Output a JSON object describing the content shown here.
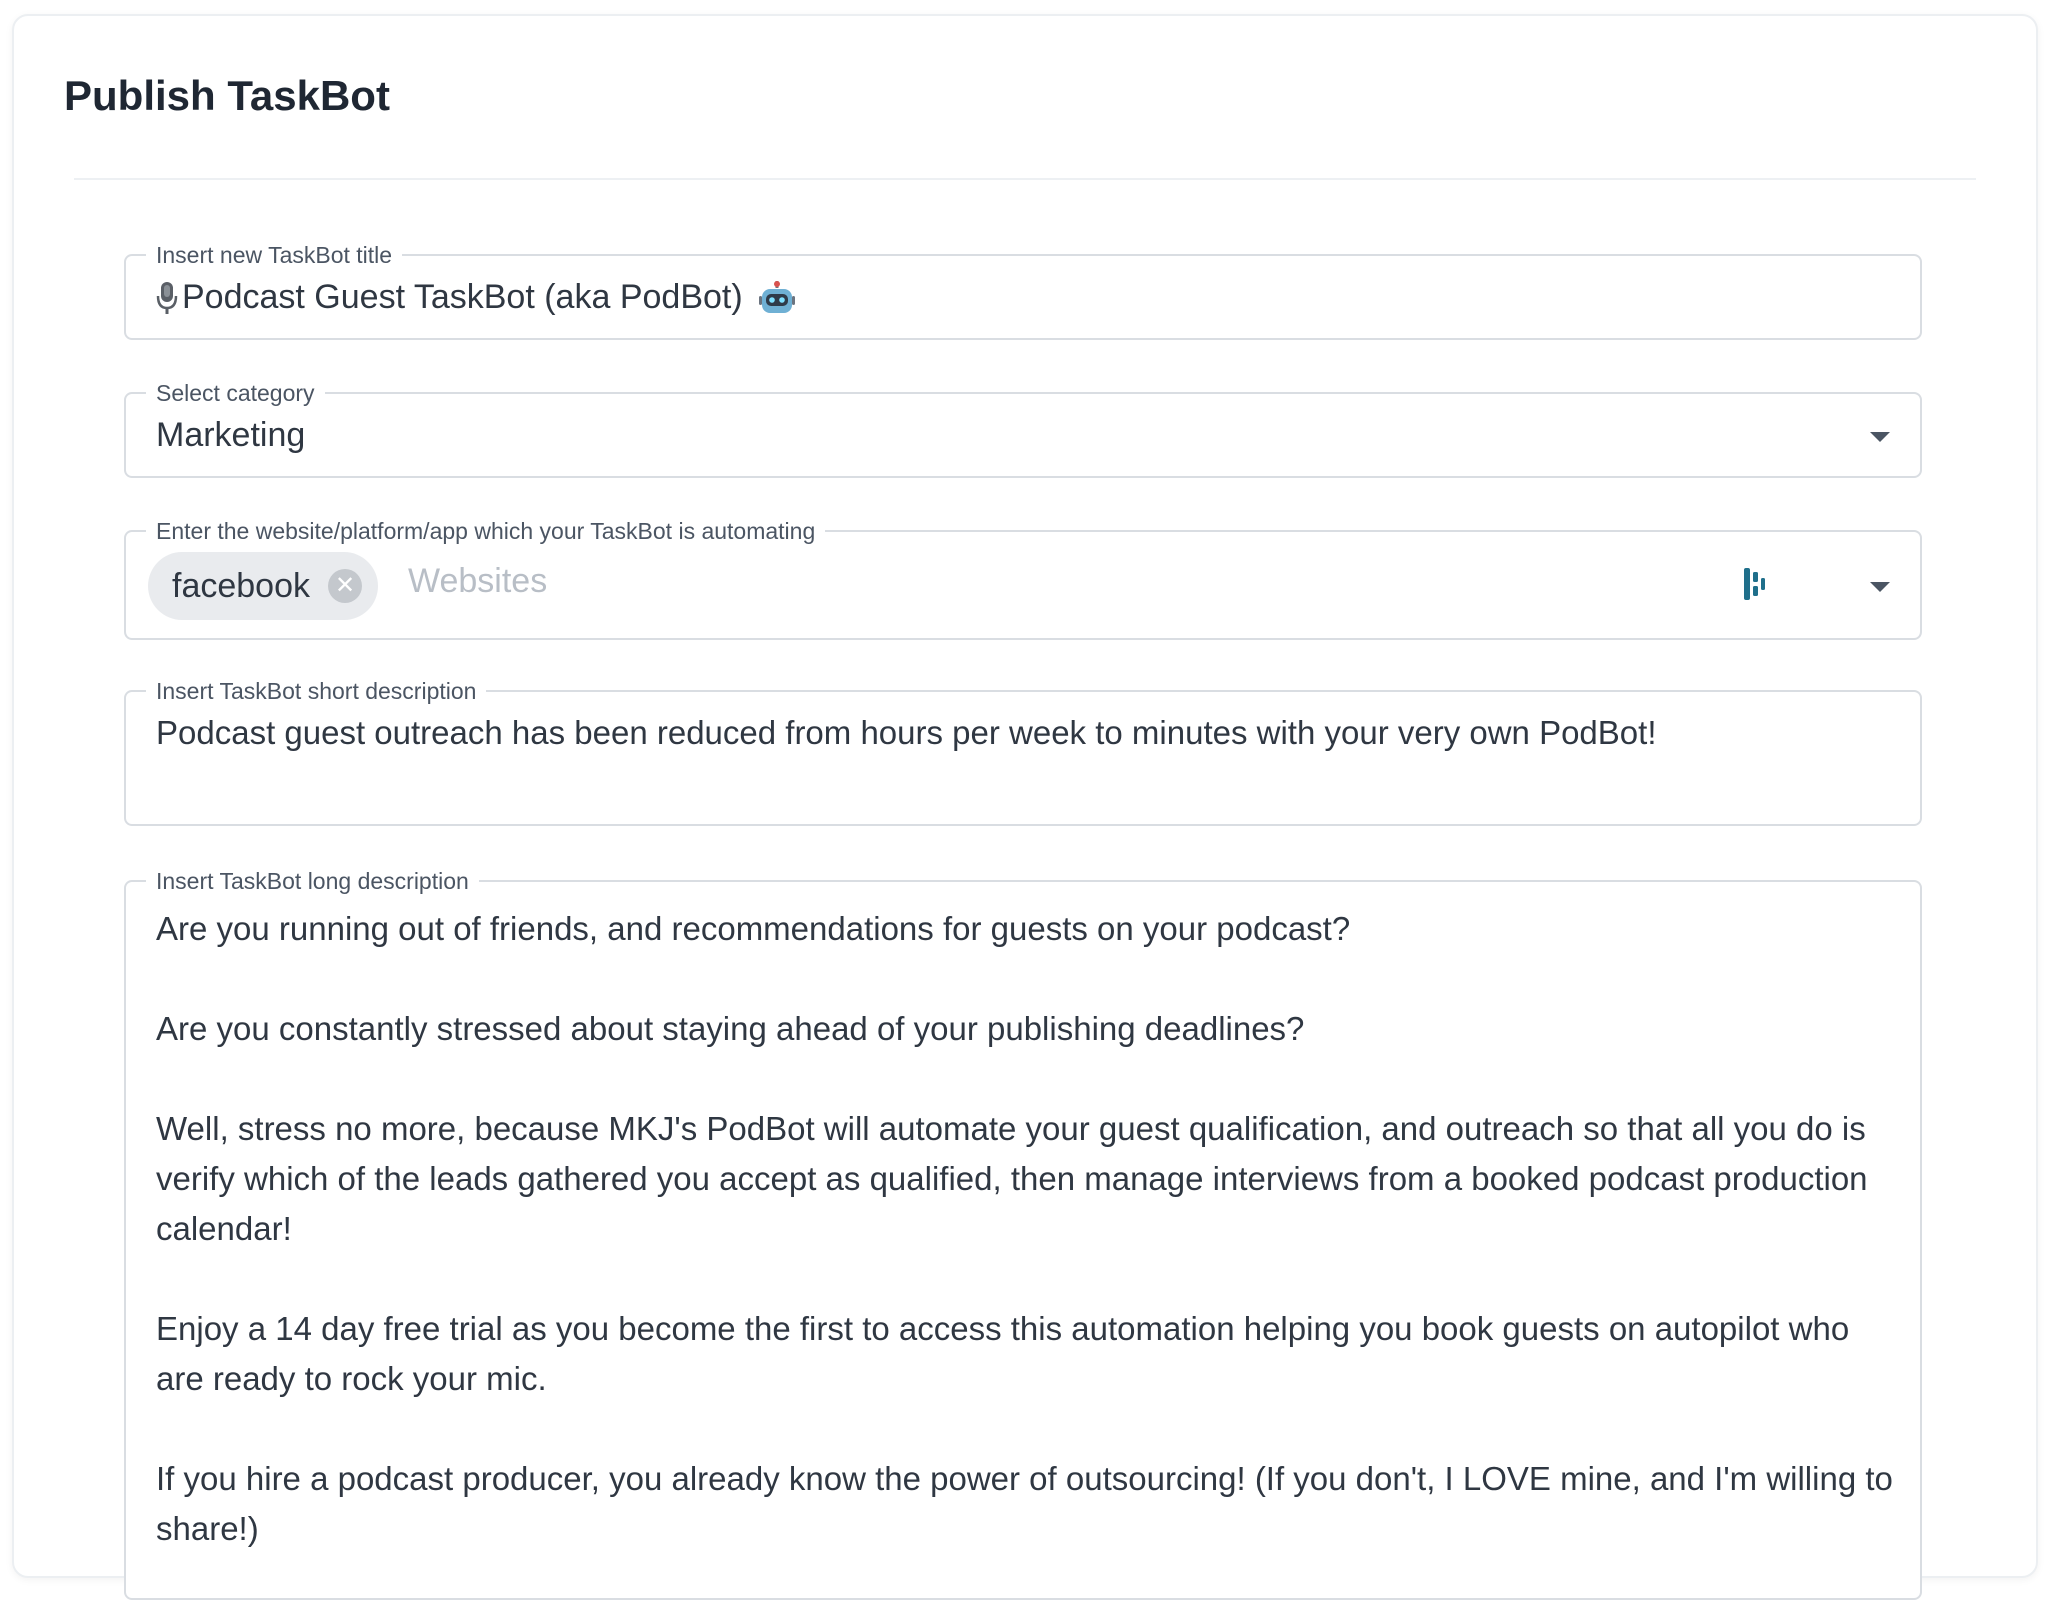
{
  "header": {
    "title": "Publish TaskBot"
  },
  "form": {
    "title_field": {
      "label": "Insert new TaskBot title",
      "value": "Podcast Guest TaskBot (aka PodBot)",
      "leading_icon": "microphone-icon",
      "trailing_icon": "robot-icon"
    },
    "category_field": {
      "label": "Select category",
      "value": "Marketing"
    },
    "website_field": {
      "label": "Enter the website/platform/app which your TaskBot is automating",
      "chips": [
        {
          "label": "facebook"
        }
      ],
      "placeholder": "Websites"
    },
    "short_description": {
      "label": "Insert TaskBot short description",
      "value": "Podcast guest outreach has been reduced from hours per week to minutes with your very own PodBot!"
    },
    "long_description": {
      "label": "Insert TaskBot long description",
      "paragraphs": [
        "Are you running out of friends, and recommendations for guests on your podcast?",
        "Are you constantly stressed about staying ahead of your publishing deadlines?",
        "Well, stress no more, because MKJ's PodBot will automate your guest qualification, and outreach so that all you do is verify which of the leads gathered you accept as qualified, then manage interviews from a booked podcast production calendar!",
        "Enjoy a 14 day free trial as you become the first to access this automation helping you book guests on autopilot who are ready to rock your mic.",
        "If you hire a podcast producer, you already know the power of outsourcing! (If you don't, I LOVE mine, and I'm willing to share!)"
      ]
    }
  },
  "colors": {
    "accent_icon": "#1f6f8b",
    "border": "#d9dde2",
    "chip_bg": "#e9ebee",
    "placeholder": "#b8bec6"
  }
}
